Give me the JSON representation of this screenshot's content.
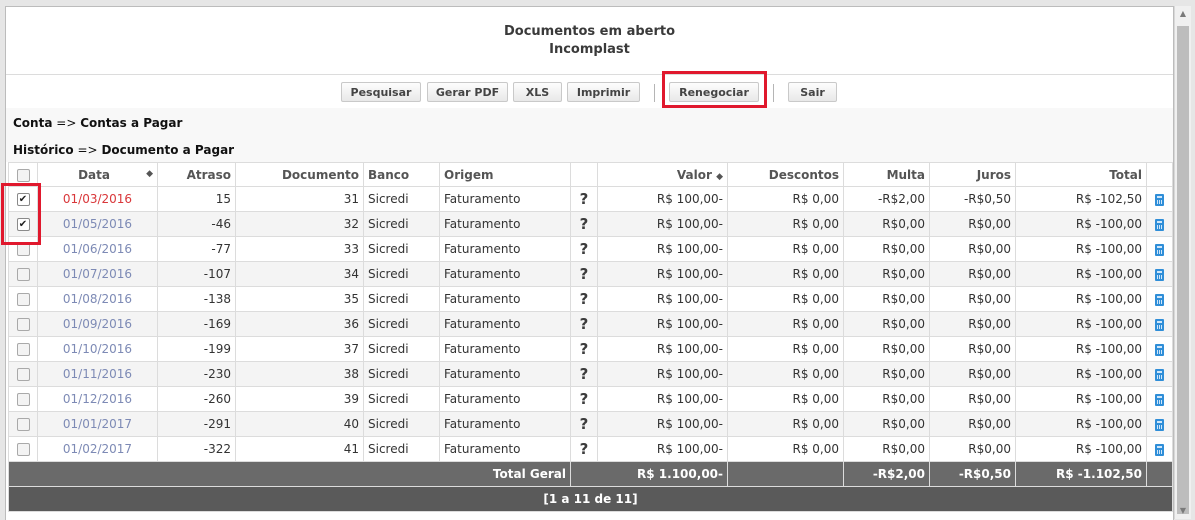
{
  "header": {
    "title": "Documentos em aberto",
    "subtitle": "Incomplast"
  },
  "toolbar": {
    "pesquisar": "Pesquisar",
    "gerar_pdf": "Gerar PDF",
    "xls": "XLS",
    "imprimir": "Imprimir",
    "renegociar": "Renegociar",
    "sair": "Sair"
  },
  "info": {
    "conta_label": "Conta",
    "conta_arrow": "=>",
    "conta_value": "Contas a Pagar",
    "historico_label": "Histórico",
    "historico_arrow": "=>",
    "historico_value": "Documento a Pagar"
  },
  "table": {
    "columns": {
      "data": "Data",
      "atraso": "Atraso",
      "documento": "Documento",
      "banco": "Banco",
      "origem": "Origem",
      "valor": "Valor",
      "descontos": "Descontos",
      "multa": "Multa",
      "juros": "Juros",
      "total": "Total"
    },
    "rows": [
      {
        "checked": true,
        "data": "01/03/2016",
        "overdue_highlight": true,
        "atraso": "15",
        "documento": "31",
        "banco": "Sicredi",
        "origem": "Faturamento",
        "valor": "R$ 100,00-",
        "descontos": "R$ 0,00",
        "multa": "-R$2,00",
        "juros": "-R$0,50",
        "total": "R$ -102,50"
      },
      {
        "checked": true,
        "data": "01/05/2016",
        "overdue_highlight": false,
        "atraso": "-46",
        "documento": "32",
        "banco": "Sicredi",
        "origem": "Faturamento",
        "valor": "R$ 100,00-",
        "descontos": "R$ 0,00",
        "multa": "R$0,00",
        "juros": "R$0,00",
        "total": "R$ -100,00"
      },
      {
        "checked": false,
        "data": "01/06/2016",
        "overdue_highlight": false,
        "atraso": "-77",
        "documento": "33",
        "banco": "Sicredi",
        "origem": "Faturamento",
        "valor": "R$ 100,00-",
        "descontos": "R$ 0,00",
        "multa": "R$0,00",
        "juros": "R$0,00",
        "total": "R$ -100,00"
      },
      {
        "checked": false,
        "data": "01/07/2016",
        "overdue_highlight": false,
        "atraso": "-107",
        "documento": "34",
        "banco": "Sicredi",
        "origem": "Faturamento",
        "valor": "R$ 100,00-",
        "descontos": "R$ 0,00",
        "multa": "R$0,00",
        "juros": "R$0,00",
        "total": "R$ -100,00"
      },
      {
        "checked": false,
        "data": "01/08/2016",
        "overdue_highlight": false,
        "atraso": "-138",
        "documento": "35",
        "banco": "Sicredi",
        "origem": "Faturamento",
        "valor": "R$ 100,00-",
        "descontos": "R$ 0,00",
        "multa": "R$0,00",
        "juros": "R$0,00",
        "total": "R$ -100,00"
      },
      {
        "checked": false,
        "data": "01/09/2016",
        "overdue_highlight": false,
        "atraso": "-169",
        "documento": "36",
        "banco": "Sicredi",
        "origem": "Faturamento",
        "valor": "R$ 100,00-",
        "descontos": "R$ 0,00",
        "multa": "R$0,00",
        "juros": "R$0,00",
        "total": "R$ -100,00"
      },
      {
        "checked": false,
        "data": "01/10/2016",
        "overdue_highlight": false,
        "atraso": "-199",
        "documento": "37",
        "banco": "Sicredi",
        "origem": "Faturamento",
        "valor": "R$ 100,00-",
        "descontos": "R$ 0,00",
        "multa": "R$0,00",
        "juros": "R$0,00",
        "total": "R$ -100,00"
      },
      {
        "checked": false,
        "data": "01/11/2016",
        "overdue_highlight": false,
        "atraso": "-230",
        "documento": "38",
        "banco": "Sicredi",
        "origem": "Faturamento",
        "valor": "R$ 100,00-",
        "descontos": "R$ 0,00",
        "multa": "R$0,00",
        "juros": "R$0,00",
        "total": "R$ -100,00"
      },
      {
        "checked": false,
        "data": "01/12/2016",
        "overdue_highlight": false,
        "atraso": "-260",
        "documento": "39",
        "banco": "Sicredi",
        "origem": "Faturamento",
        "valor": "R$ 100,00-",
        "descontos": "R$ 0,00",
        "multa": "R$0,00",
        "juros": "R$0,00",
        "total": "R$ -100,00"
      },
      {
        "checked": false,
        "data": "01/01/2017",
        "overdue_highlight": false,
        "atraso": "-291",
        "documento": "40",
        "banco": "Sicredi",
        "origem": "Faturamento",
        "valor": "R$ 100,00-",
        "descontos": "R$ 0,00",
        "multa": "R$0,00",
        "juros": "R$0,00",
        "total": "R$ -100,00"
      },
      {
        "checked": false,
        "data": "01/02/2017",
        "overdue_highlight": false,
        "atraso": "-322",
        "documento": "41",
        "banco": "Sicredi",
        "origem": "Faturamento",
        "valor": "R$ 100,00-",
        "descontos": "R$ 0,00",
        "multa": "R$0,00",
        "juros": "R$0,00",
        "total": "R$ -100,00"
      }
    ],
    "row_icons": {
      "origin_info": "question-mark-icon",
      "action": "calculator-icon"
    },
    "totals": {
      "label": "Total Geral",
      "valor": "R$ 1.100,00-",
      "multa": "-R$2,00",
      "juros": "-R$0,50",
      "total": "R$ -1.102,50"
    },
    "pager": "[1 a 11 de 11]"
  },
  "colors": {
    "highlight_border": "#e0182d",
    "overdue_date": "#d9373a",
    "date_link": "#7d8ab5",
    "footer_bg": "#6a6a6a",
    "calc_icon": "#2f8ed8"
  }
}
